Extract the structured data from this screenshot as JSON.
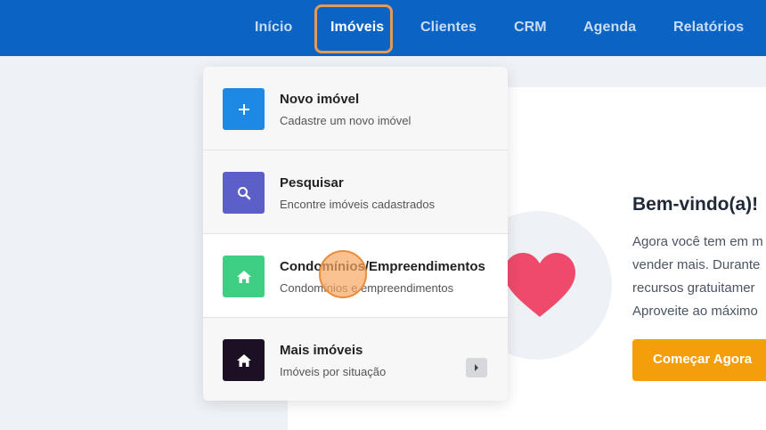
{
  "nav": {
    "items": [
      {
        "label": "Início"
      },
      {
        "label": "Imóveis"
      },
      {
        "label": "Clientes"
      },
      {
        "label": "CRM"
      },
      {
        "label": "Agenda"
      },
      {
        "label": "Relatórios"
      }
    ],
    "active": "Imóveis"
  },
  "dropdown": {
    "items": [
      {
        "title": "Novo imóvel",
        "subtitle": "Cadastre um novo imóvel",
        "icon": "plus-icon",
        "color": "#1e88e5"
      },
      {
        "title": "Pesquisar",
        "subtitle": "Encontre imóveis cadastrados",
        "icon": "search-icon",
        "color": "#5b5fc7"
      },
      {
        "title": "Condomínios/Empreendimentos",
        "subtitle": "Condomínios e empreendimentos",
        "icon": "home-icon",
        "color": "#3ecf82"
      },
      {
        "title": "Mais imóveis",
        "subtitle": "Imóveis por situação",
        "icon": "home-icon",
        "color": "#1c1024"
      }
    ]
  },
  "welcome": {
    "title": "Bem-vindo(a)!",
    "lines": [
      "Agora você tem em m",
      "vender mais. Durante",
      "recursos gratuitamer",
      "Aproveite ao máximo"
    ],
    "cta_label": "Começar Agora",
    "heart_color": "#ef4a6b",
    "cta_color": "#f59e0b"
  },
  "colors": {
    "topbar": "#0b63c4",
    "highlight": "#e39a57"
  }
}
